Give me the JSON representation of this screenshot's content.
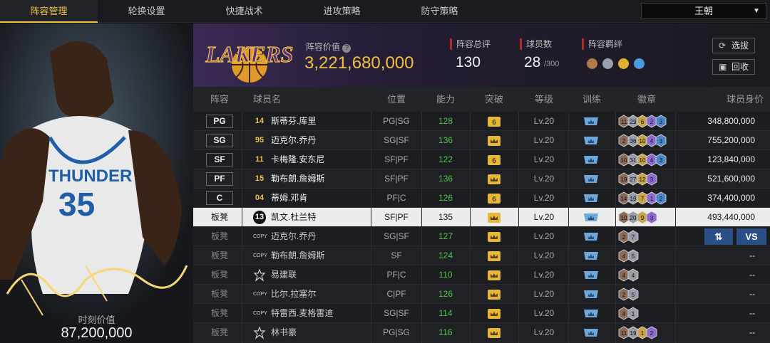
{
  "tabs": [
    {
      "label": "阵容管理",
      "active": true
    },
    {
      "label": "轮换设置",
      "active": false
    },
    {
      "label": "快捷战术",
      "active": false
    },
    {
      "label": "进攻策略",
      "active": false
    },
    {
      "label": "防守策略",
      "active": false
    }
  ],
  "player_select": {
    "value": "王朝"
  },
  "card": {
    "jersey_team": "THUNDER",
    "jersey_number": "35",
    "label": "时刻价值",
    "value": "87,200,000"
  },
  "summary": {
    "team_logo": "LAKERS",
    "lineup_value_label": "阵容价值",
    "lineup_value": "3,221,680,000",
    "rating_label": "阵容总评",
    "rating": "130",
    "count_label": "球员数",
    "count": "28",
    "count_max": "/300",
    "bond_label": "阵容羁绊",
    "select_btn": "选拔",
    "recycle_btn": "回收"
  },
  "columns": [
    "阵容",
    "球员名",
    "位置",
    "能力",
    "突破",
    "等级",
    "训练",
    "徽章",
    "球员身价"
  ],
  "rows": [
    {
      "slot": "PG",
      "starter": true,
      "num": "14",
      "name": "斯蒂芬.库里",
      "pos": "PG|SG",
      "ability": "128",
      "break": "6",
      "level": "Lv.20",
      "badges": [
        "11",
        "29",
        "6",
        "2",
        "3"
      ],
      "value": "348,800,000"
    },
    {
      "slot": "SG",
      "starter": true,
      "num": "95",
      "name": "迈克尔.乔丹",
      "pos": "SG|SF",
      "ability": "136",
      "break": "crown",
      "level": "Lv.20",
      "badges": [
        "2",
        "36",
        "10",
        "4",
        "3"
      ],
      "value": "755,200,000"
    },
    {
      "slot": "SF",
      "starter": true,
      "num": "11",
      "name": "卡梅隆.安东尼",
      "pos": "SF|PF",
      "ability": "122",
      "break": "6",
      "level": "Lv.20",
      "badges": [
        "10",
        "31",
        "10",
        "4",
        "3"
      ],
      "value": "123,840,000"
    },
    {
      "slot": "PF",
      "starter": true,
      "num": "15",
      "name": "勒布朗.詹姆斯",
      "pos": "SF|PF",
      "ability": "136",
      "break": "crown",
      "level": "Lv.20",
      "badges": [
        "19",
        "27",
        "12",
        "3"
      ],
      "value": "521,600,000"
    },
    {
      "slot": "C",
      "starter": true,
      "num": "04",
      "name": "蒂姆.邓肯",
      "pos": "PF|C",
      "ability": "126",
      "break": "6",
      "level": "Lv.20",
      "badges": [
        "14",
        "19",
        "7",
        "1",
        "2"
      ],
      "value": "374,400,000"
    },
    {
      "slot": "板凳",
      "starter": false,
      "num": "13",
      "name": "凯文.杜兰特",
      "pos": "SF|PF",
      "ability": "135",
      "break": "crown",
      "level": "Lv.20",
      "badges": [
        "10",
        "20",
        "9",
        "3"
      ],
      "value": "493,440,000"
    },
    {
      "slot": "板凳",
      "starter": false,
      "num": "COPY",
      "name": "迈克尔.乔丹",
      "pos": "SG|SF",
      "ability": "127",
      "break": "crown",
      "level": "Lv.20",
      "badges": [
        "2",
        "7"
      ],
      "value": ""
    },
    {
      "slot": "板凳",
      "starter": false,
      "num": "COPY",
      "name": "勒布朗.詹姆斯",
      "pos": "SF",
      "ability": "124",
      "break": "crown",
      "level": "Lv.20",
      "badges": [
        "4",
        "5"
      ],
      "value": "--"
    },
    {
      "slot": "板凳",
      "starter": false,
      "num": "star",
      "name": "易建联",
      "pos": "PF|C",
      "ability": "110",
      "break": "crown",
      "level": "Lv.20",
      "badges": [
        "4",
        "4"
      ],
      "value": "--"
    },
    {
      "slot": "板凳",
      "starter": false,
      "num": "COPY",
      "name": "比尔.拉塞尔",
      "pos": "C|PF",
      "ability": "126",
      "break": "crown",
      "level": "Lv.20",
      "badges": [
        "2",
        "5"
      ],
      "value": "--"
    },
    {
      "slot": "板凳",
      "starter": false,
      "num": "COPY",
      "name": "特雷西.麦格雷迪",
      "pos": "SG|SF",
      "ability": "114",
      "break": "crown",
      "level": "Lv.20",
      "badges": [
        "4",
        "1"
      ],
      "value": "--"
    },
    {
      "slot": "板凳",
      "starter": false,
      "num": "star",
      "name": "林书豪",
      "pos": "PG|SG",
      "ability": "116",
      "break": "crown",
      "level": "Lv.20",
      "badges": [
        "11",
        "19",
        "1",
        "2"
      ],
      "value": "--"
    }
  ],
  "swap_btn": "⇅",
  "vs_btn": "VS",
  "colors": {
    "accent": "#f0c040",
    "ability": "#4fc34f",
    "action": "#2a4f86"
  }
}
